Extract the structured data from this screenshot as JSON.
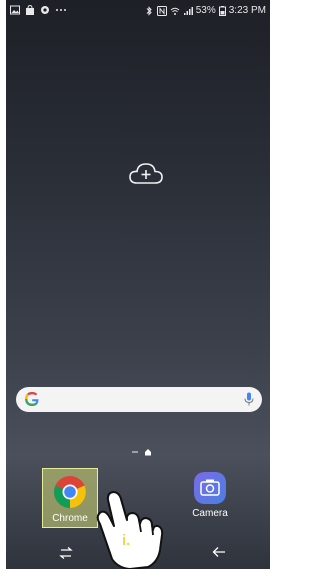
{
  "status_bar": {
    "battery": "53%",
    "time": "3:23 PM"
  },
  "icons": {
    "add_page": "cloud-add-icon",
    "google": "google-g-icon",
    "mic": "mic-icon"
  },
  "dock": {
    "apps": [
      {
        "label": "Chrome",
        "icon": "chrome-icon"
      },
      {
        "label": "Camera",
        "icon": "camera-icon"
      }
    ]
  },
  "overlay": {
    "hint": "i."
  },
  "colors": {
    "chrome_highlight": "#d6dd78",
    "camera_gradient_start": "#7a6be8",
    "camera_gradient_end": "#4a7fe0",
    "hint_text": "#f7d24a"
  }
}
